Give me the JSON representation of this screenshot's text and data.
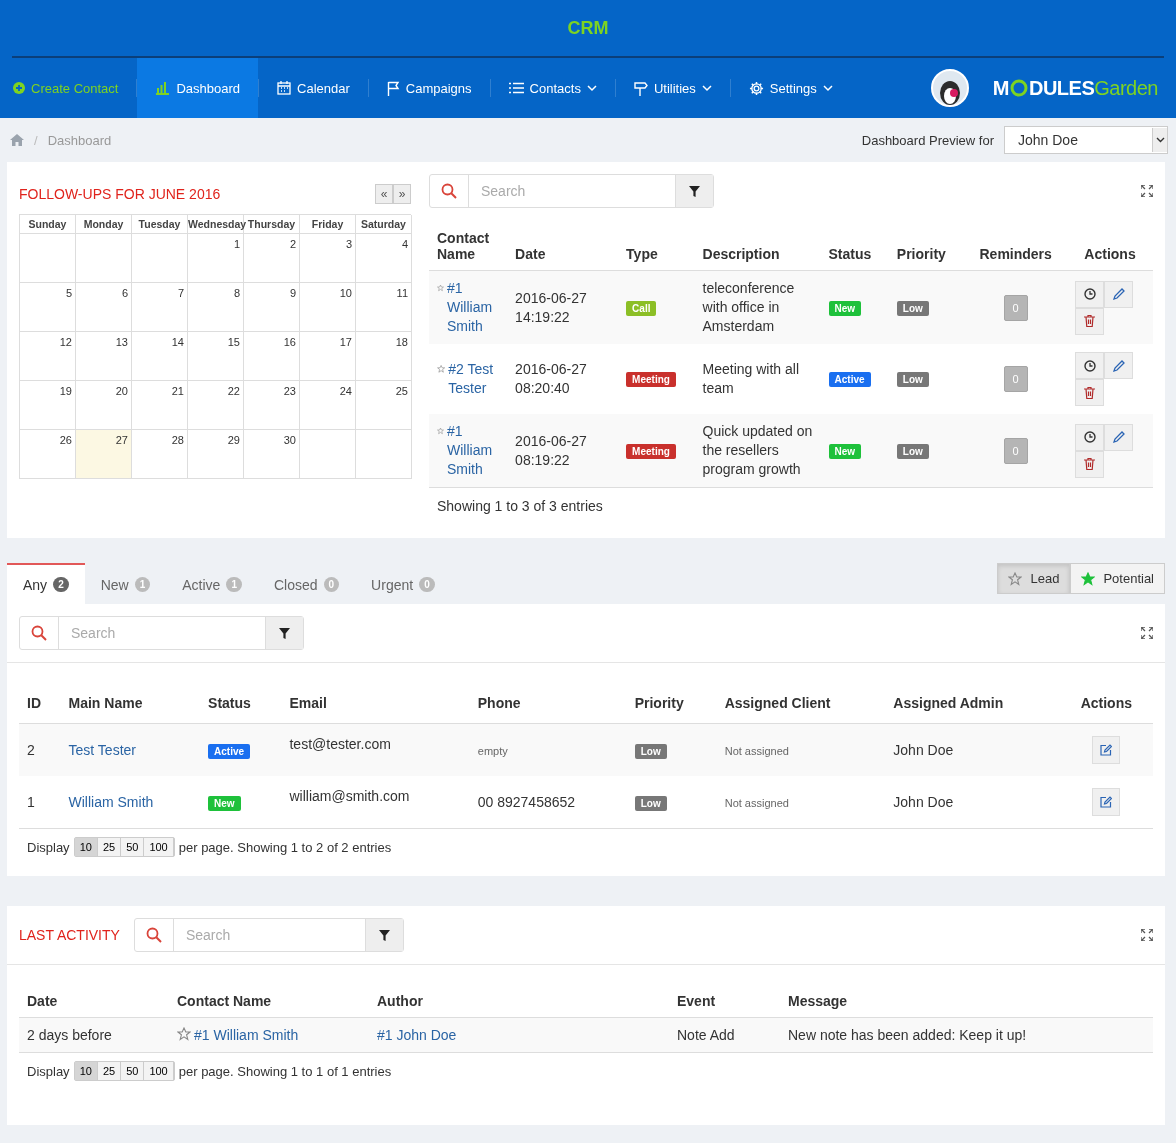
{
  "header": {
    "title": "CRM"
  },
  "nav": [
    {
      "label": "Create Contact",
      "kind": "action",
      "selected": false,
      "dropdown": false
    },
    {
      "label": "Dashboard",
      "kind": "link",
      "selected": true,
      "dropdown": false
    },
    {
      "label": "Calendar",
      "kind": "link",
      "selected": false,
      "dropdown": false
    },
    {
      "label": "Campaigns",
      "kind": "link",
      "selected": false,
      "dropdown": false
    },
    {
      "label": "Contacts",
      "kind": "link",
      "selected": false,
      "dropdown": true
    },
    {
      "label": "Utilities",
      "kind": "link",
      "selected": false,
      "dropdown": true
    },
    {
      "label": "Settings",
      "kind": "link",
      "selected": false,
      "dropdown": true
    }
  ],
  "logo": {
    "lead": "M",
    "middle": "DULES",
    "tail": "Garden"
  },
  "breadcrumb": [
    {
      "separator": "/",
      "label": "Dashboard"
    }
  ],
  "preview": {
    "label": "Dashboard Preview for",
    "value": "John Doe"
  },
  "followups": {
    "title": "FOLLOW-UPS FOR JUNE 2016",
    "prev": "«",
    "next": "»",
    "weekdays": [
      "Sunday",
      "Monday",
      "Tuesday",
      "Wednesday",
      "Thursday",
      "Friday",
      "Saturday"
    ],
    "weeks": [
      [
        {
          "kind": "blank"
        },
        {
          "kind": "blank"
        },
        {
          "kind": "blank"
        },
        {
          "day": "1",
          "today": false
        },
        {
          "day": "2",
          "today": false
        },
        {
          "day": "3",
          "today": false
        },
        {
          "day": "4",
          "today": false
        }
      ],
      [
        {
          "day": "5",
          "today": false
        },
        {
          "day": "6",
          "today": false
        },
        {
          "day": "7",
          "today": false
        },
        {
          "day": "8",
          "today": false
        },
        {
          "day": "9",
          "today": false
        },
        {
          "day": "10",
          "today": false
        },
        {
          "day": "11",
          "today": false
        }
      ],
      [
        {
          "day": "12",
          "today": false
        },
        {
          "day": "13",
          "today": false
        },
        {
          "day": "14",
          "today": false
        },
        {
          "day": "15",
          "today": false
        },
        {
          "day": "16",
          "today": false
        },
        {
          "day": "17",
          "today": false
        },
        {
          "day": "18",
          "today": false
        }
      ],
      [
        {
          "day": "19",
          "today": false
        },
        {
          "day": "20",
          "today": false
        },
        {
          "day": "21",
          "today": false
        },
        {
          "day": "22",
          "today": false
        },
        {
          "day": "23",
          "today": false
        },
        {
          "day": "24",
          "today": false
        },
        {
          "day": "25",
          "today": false
        }
      ],
      [
        {
          "day": "26",
          "today": false
        },
        {
          "day": "27",
          "today": true
        },
        {
          "day": "28",
          "today": false
        },
        {
          "day": "29",
          "today": false
        },
        {
          "day": "30",
          "today": false
        },
        {
          "kind": "blank"
        },
        {
          "kind": "blank"
        }
      ]
    ]
  },
  "tasks": {
    "search": {
      "placeholder": "Search"
    },
    "columns": [
      "Contact Name",
      "Date",
      "Type",
      "Description",
      "Status",
      "Priority",
      "Reminders",
      "Actions"
    ],
    "rows": [
      {
        "contact_id": "#1",
        "contact_name": "William Smith",
        "date": "2016-06-27",
        "time": "14:19:22",
        "type": {
          "label": "Call",
          "kind": "call"
        },
        "description": "teleconference with office in Amsterdam",
        "status": {
          "label": "New",
          "kind": "new"
        },
        "priority": "Low",
        "reminders": "0"
      },
      {
        "contact_id": "#2",
        "contact_name": "Test Tester",
        "date": "2016-06-27",
        "time": "08:20:40",
        "type": {
          "label": "Meeting",
          "kind": "meeting"
        },
        "description": "Meeting with all team",
        "status": {
          "label": "Active",
          "kind": "active"
        },
        "priority": "Low",
        "reminders": "0"
      },
      {
        "contact_id": "#1",
        "contact_name": "William Smith",
        "date": "2016-06-27",
        "time": "08:19:22",
        "type": {
          "label": "Meeting",
          "kind": "meeting"
        },
        "description": "Quick updated on the resellers program growth",
        "status": {
          "label": "New",
          "kind": "new"
        },
        "priority": "Low",
        "reminders": "0"
      }
    ],
    "footer": "Showing 1 to 3 of 3 entries"
  },
  "contacts": {
    "tabs": [
      {
        "label": "Any",
        "count": "2",
        "selected": true
      },
      {
        "label": "New",
        "count": "1",
        "selected": false
      },
      {
        "label": "Active",
        "count": "1",
        "selected": false
      },
      {
        "label": "Closed",
        "count": "0",
        "selected": false
      },
      {
        "label": "Urgent",
        "count": "0",
        "selected": false
      }
    ],
    "toggles": [
      {
        "label": "Lead",
        "kind": "outline",
        "selected": true
      },
      {
        "label": "Potential",
        "kind": "filled",
        "selected": false
      }
    ],
    "search": {
      "placeholder": "Search"
    },
    "columns": [
      "ID",
      "Main Name",
      "Status",
      "Email",
      "Phone",
      "Priority",
      "Assigned Client",
      "Assigned Admin",
      "Actions"
    ],
    "rows": [
      {
        "id": "2",
        "name": "Test Tester",
        "status": {
          "label": "Active",
          "kind": "active"
        },
        "email": "test@tester.com",
        "phone": "empty",
        "phone_empty": true,
        "priority": "Low",
        "client": "Not assigned",
        "admin": "John Doe"
      },
      {
        "id": "1",
        "name": "William Smith",
        "status": {
          "label": "New",
          "kind": "new"
        },
        "email": "william@smith.com",
        "phone": "00 8927458652",
        "phone_empty": false,
        "priority": "Low",
        "client": "Not assigned",
        "admin": "John Doe"
      }
    ],
    "pager": {
      "label": "Display",
      "sizes": [
        {
          "label": "10",
          "selected": true
        },
        {
          "label": "25",
          "selected": false
        },
        {
          "label": "50",
          "selected": false
        },
        {
          "label": "100",
          "selected": false
        }
      ],
      "info": "per page. Showing 1 to 2 of 2 entries"
    }
  },
  "activity": {
    "title": "LAST ACTIVITY",
    "search": {
      "placeholder": "Search"
    },
    "columns": [
      "Date",
      "Contact Name",
      "Author",
      "Event",
      "Message"
    ],
    "rows": [
      {
        "date": "2 days before",
        "contact": "#1 William Smith",
        "author": "#1 John Doe",
        "event": "Note Add",
        "message": "New note has been added: Keep it up!"
      }
    ],
    "pager": {
      "label": "Display",
      "sizes": [
        {
          "label": "10",
          "selected": true
        },
        {
          "label": "25",
          "selected": false
        },
        {
          "label": "50",
          "selected": false
        },
        {
          "label": "100",
          "selected": false
        }
      ],
      "info": "per page. Showing 1 to 1 of 1 entries"
    }
  }
}
